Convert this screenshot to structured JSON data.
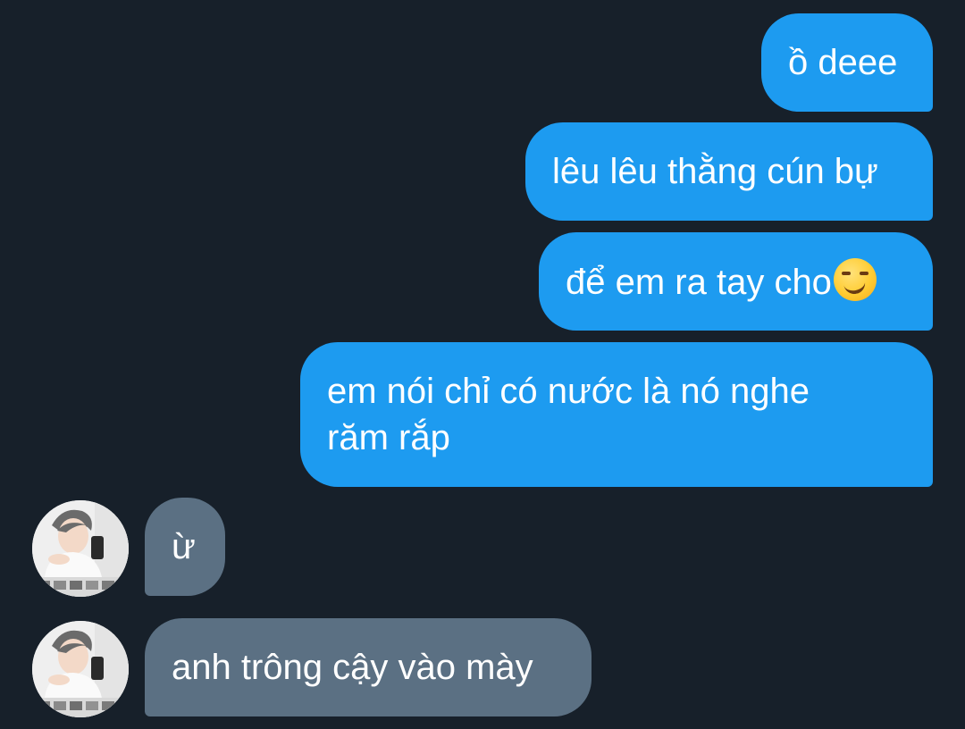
{
  "messages": [
    {
      "sender": "me",
      "text": "ồ deee"
    },
    {
      "sender": "me",
      "text": "lêu lêu thằng cún bự"
    },
    {
      "sender": "me",
      "text": "để em ra tay cho",
      "emoji": "smirking-face-emoji"
    },
    {
      "sender": "me",
      "text": "em nói chỉ có nước là nó nghe răm rắp"
    },
    {
      "sender": "other",
      "text": "ừ",
      "avatar": "profile-photo"
    },
    {
      "sender": "other",
      "text": "anh trông cậy vào mày",
      "avatar": "profile-photo"
    }
  ],
  "colors": {
    "background": "#17202a",
    "outgoing_bubble": "#1d9bf0",
    "incoming_bubble": "#5b7083",
    "text": "#ffffff"
  }
}
